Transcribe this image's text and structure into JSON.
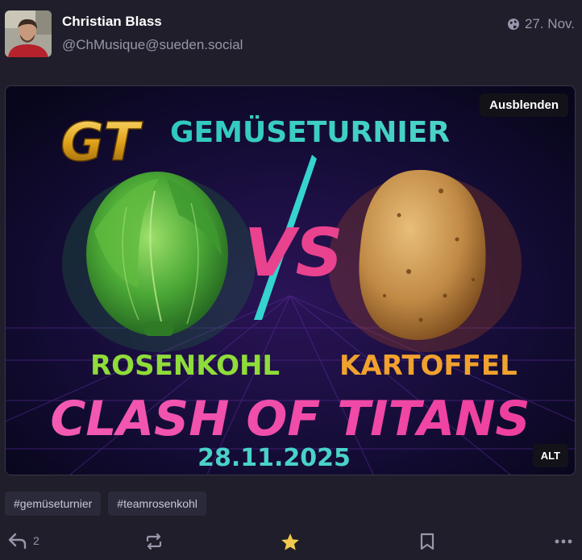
{
  "author": {
    "display_name": "Christian Blass",
    "handle": "@ChMusique@sueden.social",
    "avatar_icon": "avatar-photo"
  },
  "meta": {
    "visibility_icon": "globe-icon",
    "date": "27. Nov."
  },
  "media": {
    "hide_label": "Ausblenden",
    "alt_label": "ALT",
    "poster": {
      "logo": "GT",
      "title": "GEMÜSETURNIER",
      "versus": "VS",
      "left_name": "ROSENKOHL",
      "right_name": "KARTOFFEL",
      "headline": "CLASH OF TITANS",
      "date": "28.11.2025"
    }
  },
  "hashtags": [
    "#gemüseturnier",
    "#teamrosenkohl"
  ],
  "actions": {
    "reply_count": "2",
    "favourited": true,
    "colors": {
      "star": "#f2c94c",
      "icon": "#9897ab"
    }
  }
}
